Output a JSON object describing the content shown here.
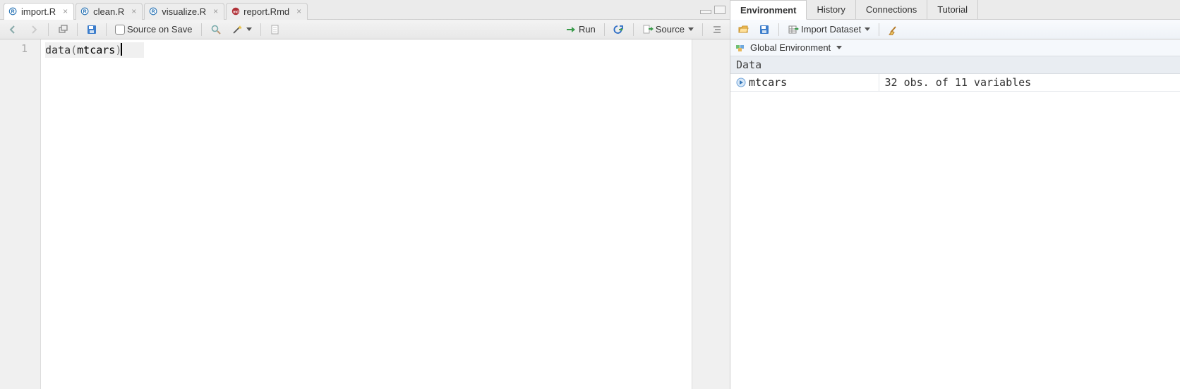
{
  "editor": {
    "tabs": [
      {
        "label": "import.R",
        "type": "r",
        "active": true
      },
      {
        "label": "clean.R",
        "type": "r",
        "active": false
      },
      {
        "label": "visualize.R",
        "type": "r",
        "active": false
      },
      {
        "label": "report.Rmd",
        "type": "rmd",
        "active": false
      }
    ],
    "toolbar": {
      "source_on_save_label": "Source on Save",
      "run_label": "Run",
      "source_label": "Source"
    },
    "code": {
      "line_number": "1",
      "fn": "data",
      "open": "(",
      "ident": "mtcars",
      "close": ")"
    }
  },
  "env": {
    "tabs": [
      {
        "label": "Environment",
        "active": true
      },
      {
        "label": "History",
        "active": false
      },
      {
        "label": "Connections",
        "active": false
      },
      {
        "label": "Tutorial",
        "active": false
      }
    ],
    "toolbar": {
      "import_label": "Import Dataset"
    },
    "scope_label": "Global Environment",
    "section_label": "Data",
    "rows": [
      {
        "name": "mtcars",
        "desc": "32 obs. of 11 variables"
      }
    ]
  }
}
